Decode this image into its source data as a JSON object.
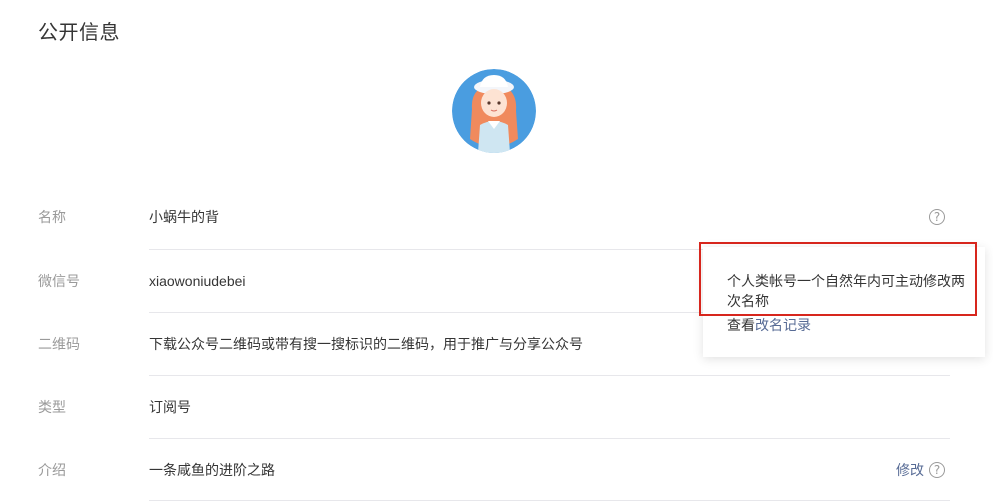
{
  "section": {
    "title": "公开信息"
  },
  "rows": [
    {
      "label": "名称",
      "value": "小蜗牛的背"
    },
    {
      "label": "微信号",
      "value": "xiaowoniudebei"
    },
    {
      "label": "二维码",
      "value": "下载公众号二维码或带有搜一搜标识的二维码，用于推广与分享公众号"
    },
    {
      "label": "类型",
      "value": "订阅号"
    },
    {
      "label": "介绍",
      "value": "一条咸鱼的进阶之路",
      "action": "修改"
    }
  ],
  "icons": {
    "help": "help-circle-icon",
    "help_glyph": "?"
  },
  "popover": {
    "text": "个人类帐号一个自然年内可主动修改两次名称",
    "link_prefix": "查看",
    "link_label": "改名记录"
  },
  "colors": {
    "text": "#353535",
    "label": "#9a9a9a",
    "link": "#576b95",
    "highlight": "#d7261d",
    "divider": "#e7e7eb"
  }
}
